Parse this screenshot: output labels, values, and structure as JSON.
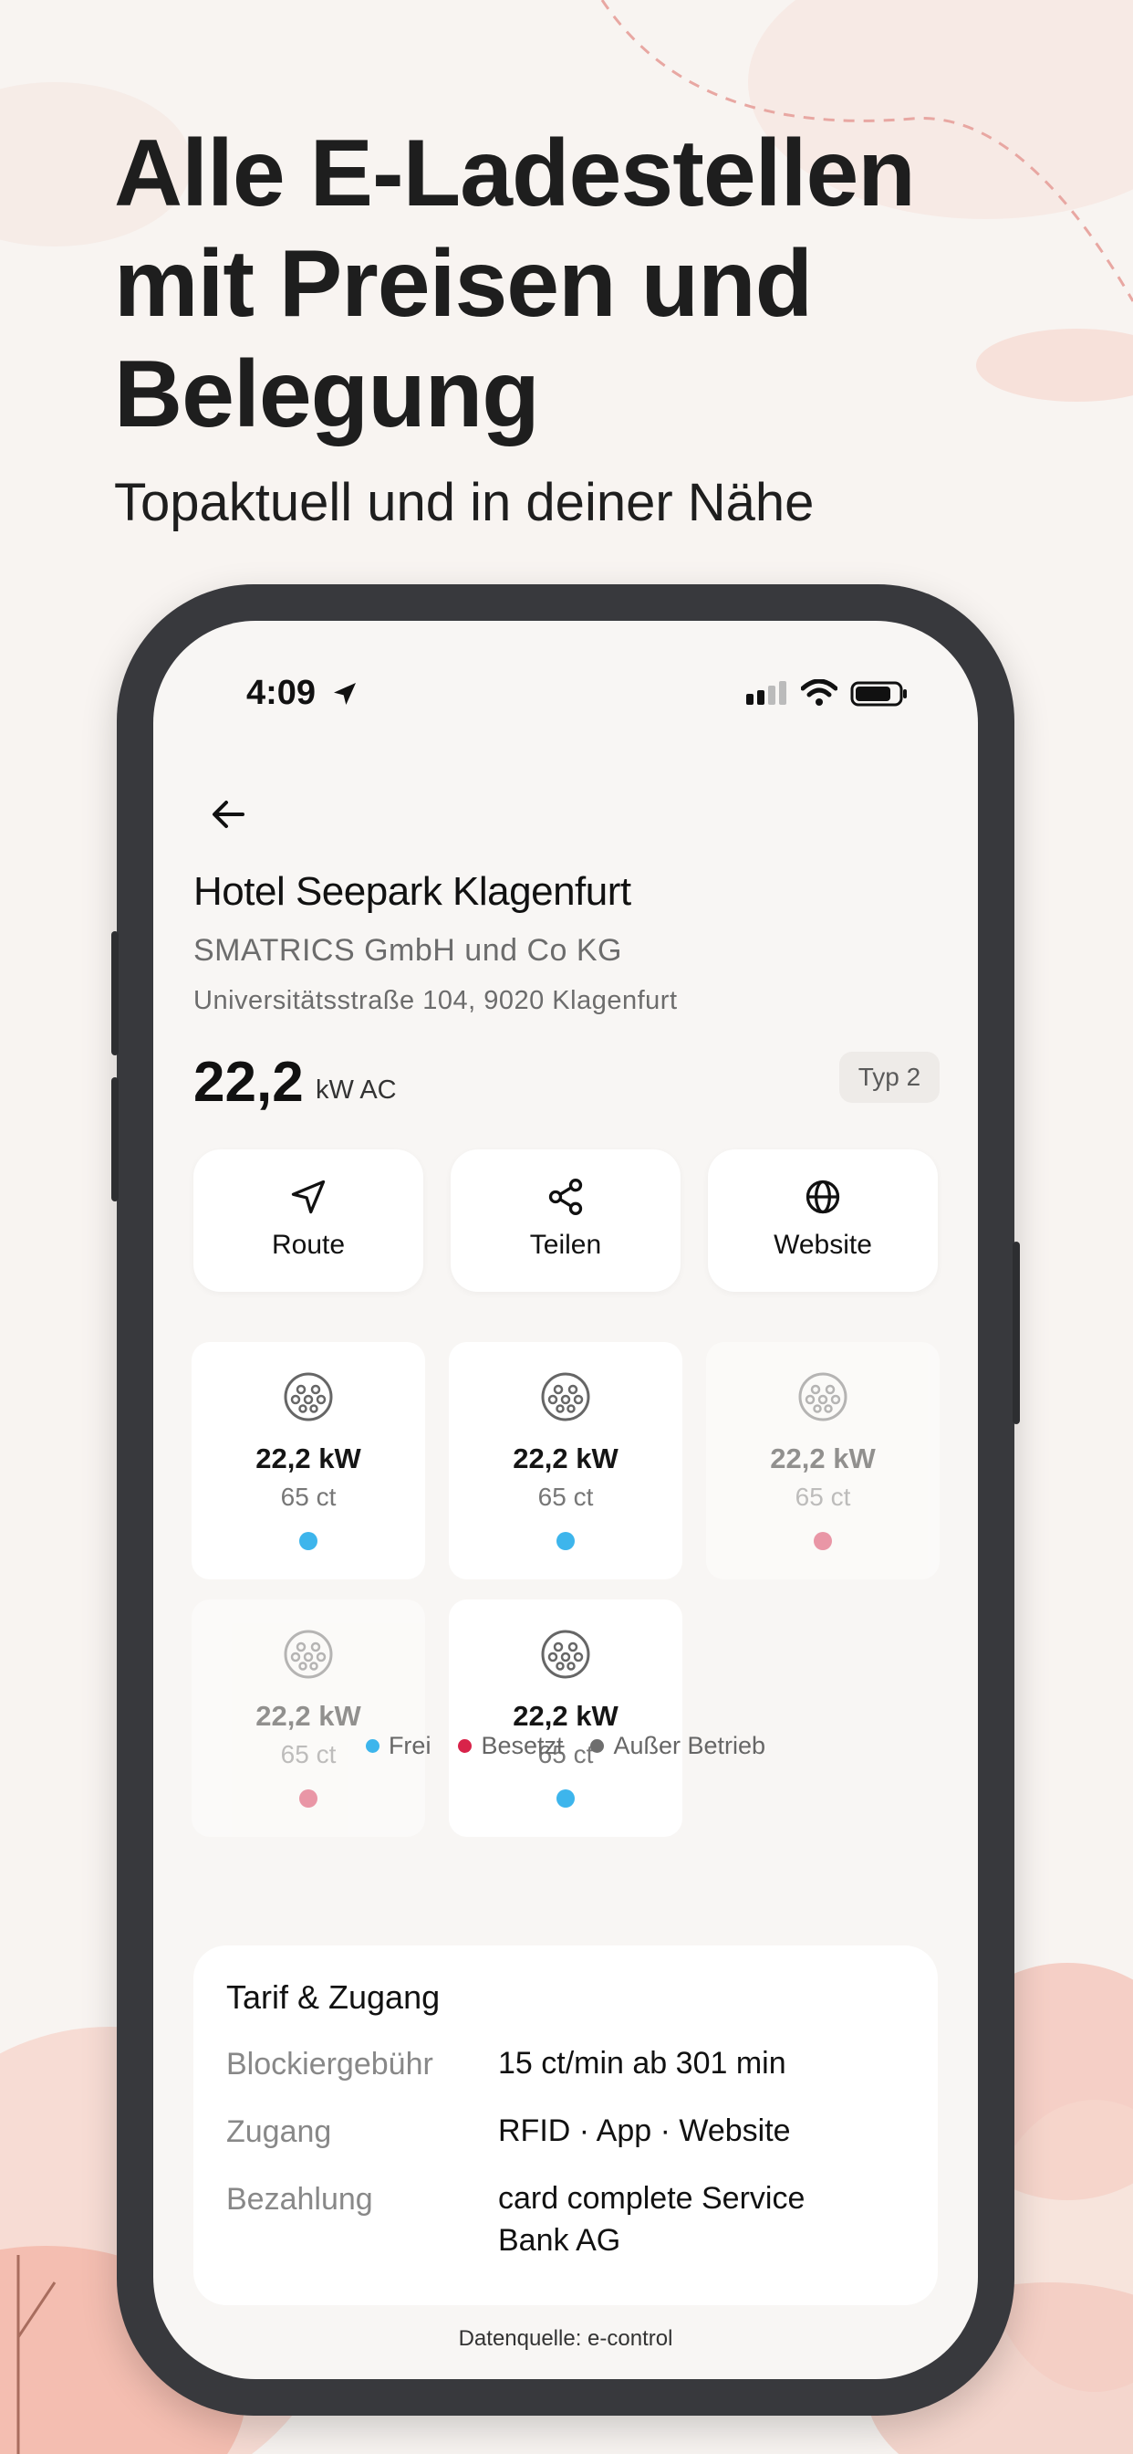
{
  "headline": "Alle E-Ladestellen\nmit Preisen und\nBelegung",
  "subline": "Topaktuell und in deiner Nähe",
  "status_bar": {
    "time": "4:09"
  },
  "station": {
    "name": "Hotel Seepark Klagenfurt",
    "operator": "SMATRICS GmbH und Co KG",
    "address": "Universitätsstraße 104, 9020 Klagenfurt",
    "power": "22,2",
    "power_unit": "kW AC",
    "plug_type": "Typ 2"
  },
  "actions": [
    {
      "label": "Route",
      "icon": "navigation-arrow-icon"
    },
    {
      "label": "Teilen",
      "icon": "share-icon"
    },
    {
      "label": "Website",
      "icon": "globe-icon"
    }
  ],
  "connectors": [
    {
      "kw": "22,2 kW",
      "price": "65 ct",
      "status": "Frei",
      "status_color": "#3db5ec"
    },
    {
      "kw": "22,2 kW",
      "price": "65 ct",
      "status": "Frei",
      "status_color": "#3db5ec"
    },
    {
      "kw": "22,2 kW",
      "price": "65 ct",
      "status": "Besetzt",
      "status_color": "#d8234a"
    },
    {
      "kw": "22,2 kW",
      "price": "65 ct",
      "status": "Besetzt",
      "status_color": "#d8234a"
    },
    {
      "kw": "22,2 kW",
      "price": "65 ct",
      "status": "Frei",
      "status_color": "#3db5ec"
    }
  ],
  "legend": [
    {
      "label": "Frei",
      "color": "#3db5ec"
    },
    {
      "label": "Besetzt",
      "color": "#d8234a"
    },
    {
      "label": "Außer Betrieb",
      "color": "#6e6e6e"
    }
  ],
  "tarif": {
    "title": "Tarif & Zugang",
    "rows": [
      {
        "key": "Blockiergebühr",
        "value": "15 ct/min ab 301 min"
      },
      {
        "key": "Zugang",
        "value": "RFID · App · Website"
      },
      {
        "key": "Bezahlung",
        "value": "card complete Service Bank AG"
      }
    ]
  },
  "source": "Datenquelle: e-control"
}
